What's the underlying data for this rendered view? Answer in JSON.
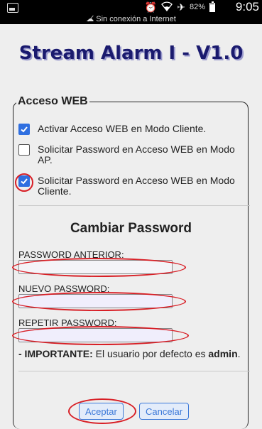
{
  "statusbar": {
    "battery_pct": "82%",
    "time": "9:05",
    "connection_text": "Sin conexión a Internet",
    "icons": [
      "image-icon",
      "alarm-icon",
      "wifi-icon",
      "airplane-icon",
      "battery-icon"
    ]
  },
  "page": {
    "title": "Stream Alarm I - V1.0"
  },
  "web": {
    "legend": "Acceso WEB",
    "options": [
      {
        "label": "Activar Acceso WEB en Modo Cliente.",
        "checked": true
      },
      {
        "label": "Solicitar Password en Acceso WEB en Modo AP.",
        "checked": false
      },
      {
        "label": "Solicitar Password en Acceso WEB en Modo Cliente.",
        "checked": true
      }
    ]
  },
  "password": {
    "section_title": "Cambiar Password",
    "old_label": "PASSWORD ANTERIOR:",
    "new_label": "NUEVO PASSWORD:",
    "repeat_label": "REPETIR PASSWORD:",
    "old_value": "",
    "new_value": "",
    "repeat_value": ""
  },
  "note": {
    "prefix": "- IMPORTANTE:",
    "text": " El usuario por defecto es ",
    "user": "admin",
    "suffix": "."
  },
  "buttons": {
    "accept": "Aceptar",
    "cancel": "Cancelar"
  },
  "colors": {
    "accent": "#3b78d8",
    "checkbox": "#2f6fe0",
    "annotation": "#d81f26",
    "title": "#1a1a6e"
  }
}
